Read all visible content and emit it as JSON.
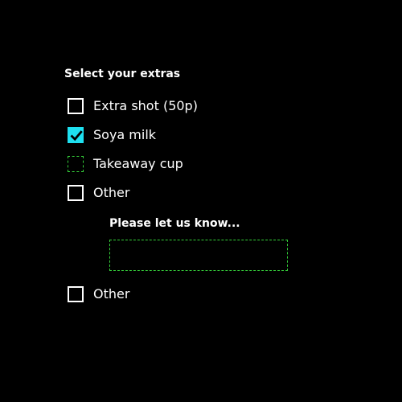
{
  "form": {
    "legend": "Select your extras",
    "options": [
      {
        "label": "Extra shot (50p)",
        "checked": false
      },
      {
        "label": "Soya milk",
        "checked": true
      },
      {
        "label": "Takeaway cup",
        "checked": false,
        "focused": true
      },
      {
        "label": "Other",
        "checked": false
      }
    ],
    "other_text": {
      "label": "Please let us know...",
      "value": "",
      "placeholder": ""
    },
    "extra_option": {
      "label": "Other",
      "checked": false
    }
  },
  "colors": {
    "background": "#000000",
    "text": "#ffffff",
    "checked_fill": "#1ee0f0",
    "focus_outline": "#35d13a"
  },
  "icons": {
    "checkmark": "checkmark-icon"
  }
}
